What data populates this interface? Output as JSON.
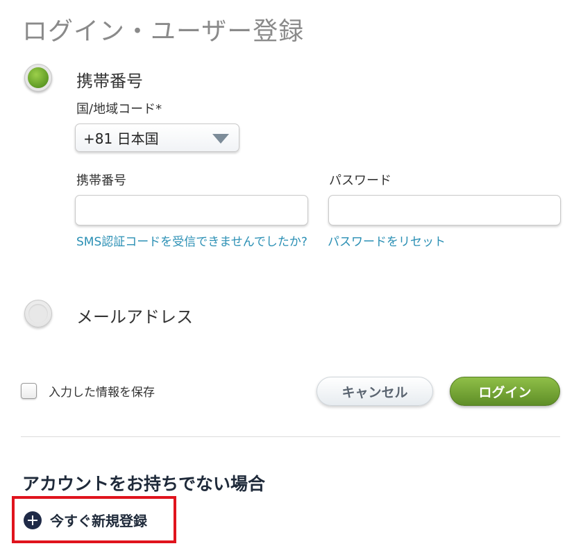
{
  "page_title": "ログイン・ユーザー登録",
  "login_method": {
    "phone_label": "携帯番号",
    "email_label": "メールアドレス",
    "selected": "phone"
  },
  "country": {
    "label": "国/地域コード*",
    "selected_value": "+81 日本国"
  },
  "mobile": {
    "label": "携帯番号",
    "value": "",
    "sms_help_link": "SMS認証コードを受信できませんでしたか?"
  },
  "password": {
    "label": "パスワード",
    "value": "",
    "reset_link": "パスワードをリセット"
  },
  "remember": {
    "label": "入力した情報を保存",
    "checked": false
  },
  "buttons": {
    "cancel": "キャンセル",
    "login": "ログイン"
  },
  "signup": {
    "heading": "アカウントをお持ちでない場合",
    "register_label": "今すぐ新規登録"
  },
  "colors": {
    "accent_green": "#6a9f2c",
    "link_blue": "#2a8fb4",
    "highlight_red": "#e0141d",
    "heading_navy": "#1f2a3a"
  }
}
